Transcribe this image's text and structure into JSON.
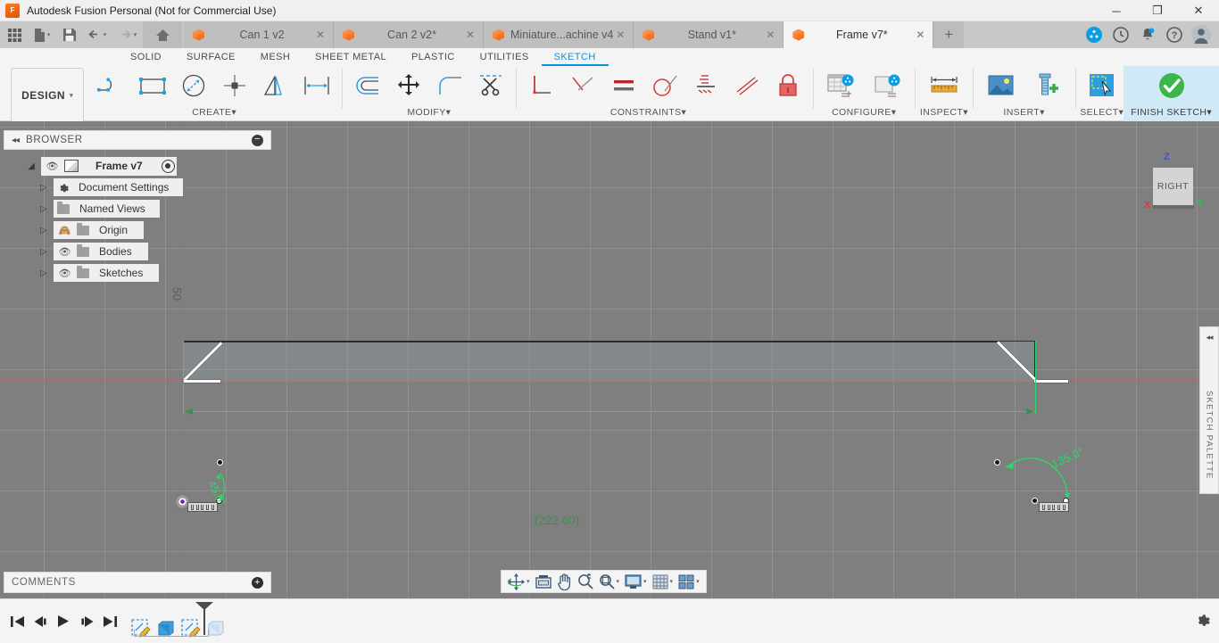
{
  "window": {
    "title": "Autodesk Fusion Personal (Not for Commercial Use)",
    "app_icon": "fusion-logo-icon",
    "minimize": "─",
    "maximize": "❐",
    "close": "✕"
  },
  "quick_access": {
    "grid_icon": "app-grid-icon",
    "new_icon": "new-document-icon",
    "save_icon": "save-icon",
    "undo_icon": "undo-icon",
    "redo_icon": "redo-icon",
    "home_icon": "home-icon",
    "caret": "▾"
  },
  "doc_tabs": [
    {
      "label": "Can 1 v2",
      "close": "✕",
      "active": false
    },
    {
      "label": "Can 2 v2*",
      "close": "✕",
      "active": false
    },
    {
      "label": "Miniature...achine v4",
      "close": "✕",
      "active": false
    },
    {
      "label": "Stand v1*",
      "close": "✕",
      "active": false
    },
    {
      "label": "Frame v7*",
      "close": "✕",
      "active": true
    }
  ],
  "tab_actions": {
    "new_tab": "+",
    "extensions_icon": "fusion-extension-icon",
    "history_icon": "job-status-clock-icon",
    "notifications_icon": "notification-bell-icon",
    "help_icon": "help-question-icon",
    "account_icon": "user-avatar-icon"
  },
  "ribbon": {
    "workspace": "DESIGN",
    "workspace_caret": "▾",
    "tabs": [
      {
        "label": "SOLID",
        "active": false
      },
      {
        "label": "SURFACE",
        "active": false
      },
      {
        "label": "MESH",
        "active": false
      },
      {
        "label": "SHEET METAL",
        "active": false
      },
      {
        "label": "PLASTIC",
        "active": false
      },
      {
        "label": "UTILITIES",
        "active": false
      },
      {
        "label": "SKETCH",
        "active": true
      }
    ],
    "groups": [
      {
        "name": "CREATE",
        "caret": "▾",
        "tools": [
          "line-icon",
          "rectangle-icon",
          "circle-diameter-icon",
          "point-icon",
          "mirror-icon",
          "offset-distance-icon"
        ]
      },
      {
        "name": "MODIFY",
        "caret": "▾",
        "tools": [
          "offset-icon",
          "move-copy-icon",
          "fillet-icon",
          "trim-scissors-icon"
        ]
      },
      {
        "name": "CONSTRAINTS",
        "caret": "▾",
        "tools": [
          "perpendicular-icon",
          "coincident-icon",
          "parallel-equal-icon",
          "tangent-icon",
          "midpoint-icon",
          "collinear-icon",
          "fix-lock-icon"
        ]
      },
      {
        "name": "CONFIGURE",
        "caret": "▾",
        "tools": [
          "configure-table-icon",
          "configure-part-icon"
        ]
      },
      {
        "name": "INSPECT",
        "caret": "▾",
        "tools": [
          "measure-ruler-icon"
        ]
      },
      {
        "name": "INSERT",
        "caret": "▾",
        "tools": [
          "insert-image-icon",
          "insert-mcmaster-part-icon"
        ]
      },
      {
        "name": "SELECT",
        "caret": "▾",
        "tools": [
          "select-window-cursor-icon"
        ]
      },
      {
        "name": "FINISH SKETCH",
        "caret": "▾",
        "tools": [
          "finish-sketch-check-icon"
        ]
      }
    ]
  },
  "browser": {
    "title": "BROWSER",
    "collapse_icon": "collapse-left-icon",
    "minimize_icon": "−",
    "root": {
      "label": "Frame v7",
      "caret": "◢",
      "eye_icon": "eye-visible-icon",
      "cube_icon": "document-cube-icon",
      "target_icon": "activate-component-icon"
    },
    "items": [
      {
        "label": "Document Settings",
        "icon": "gear-icon",
        "caret": "▷",
        "eye": null
      },
      {
        "label": "Named Views",
        "icon": "folder-icon",
        "caret": "▷",
        "eye": null
      },
      {
        "label": "Origin",
        "icon": "folder-icon",
        "caret": "▷",
        "eye": "eye-hidden-icon"
      },
      {
        "label": "Bodies",
        "icon": "folder-icon",
        "caret": "▷",
        "eye": "eye-visible-icon"
      },
      {
        "label": "Sketches",
        "icon": "folder-icon",
        "caret": "▷",
        "eye": "eye-visible-icon"
      }
    ]
  },
  "comments": {
    "title": "COMMENTS",
    "add_icon": "+"
  },
  "canvas": {
    "grid_label": "50",
    "dimensions": {
      "angle_left": "45.0°",
      "angle_right": "135.0°",
      "length_driven": "(222.60)"
    },
    "colors": {
      "dimension_green": "#2fd46a",
      "driven_green": "#3f8f4f",
      "x_axis_red": "#b06a6a",
      "y_axis_green": "#4ea24e",
      "background": "#7f7f7f",
      "accent_blue": "#0696d7"
    }
  },
  "view_cube": {
    "face": "RIGHT",
    "axis_z": "Z",
    "axis_y": "Y",
    "axis_x": "X"
  },
  "sketch_palette": {
    "label": "SKETCH PALETTE",
    "collapse_icon": "collapse-right-icon"
  },
  "nav_bar": {
    "items": [
      {
        "icon": "orbit-icon",
        "caret": "▾"
      },
      {
        "icon": "look-at-icon",
        "caret": ""
      },
      {
        "icon": "pan-hand-icon",
        "caret": ""
      },
      {
        "icon": "zoom-magnifier-icon",
        "caret": ""
      },
      {
        "icon": "fit-view-icon",
        "caret": "▾"
      },
      {
        "icon": "display-settings-monitor-icon",
        "caret": "▾"
      },
      {
        "icon": "grid-snaps-icon",
        "caret": "▾"
      },
      {
        "icon": "viewport-layout-icon",
        "caret": "▾"
      }
    ]
  },
  "timeline": {
    "controls": [
      {
        "icon": "go-to-beginning-icon"
      },
      {
        "icon": "step-back-icon"
      },
      {
        "icon": "play-icon"
      },
      {
        "icon": "step-forward-icon"
      },
      {
        "icon": "go-to-end-icon"
      }
    ],
    "nodes": [
      {
        "icon": "sketch-feature-icon"
      },
      {
        "icon": "extrude-feature-icon"
      },
      {
        "icon": "sketch-feature-icon"
      },
      {
        "icon": "extrude-light-feature-icon"
      }
    ],
    "settings_icon": "timeline-settings-gear-icon",
    "marker_icon": "timeline-marker-icon"
  }
}
